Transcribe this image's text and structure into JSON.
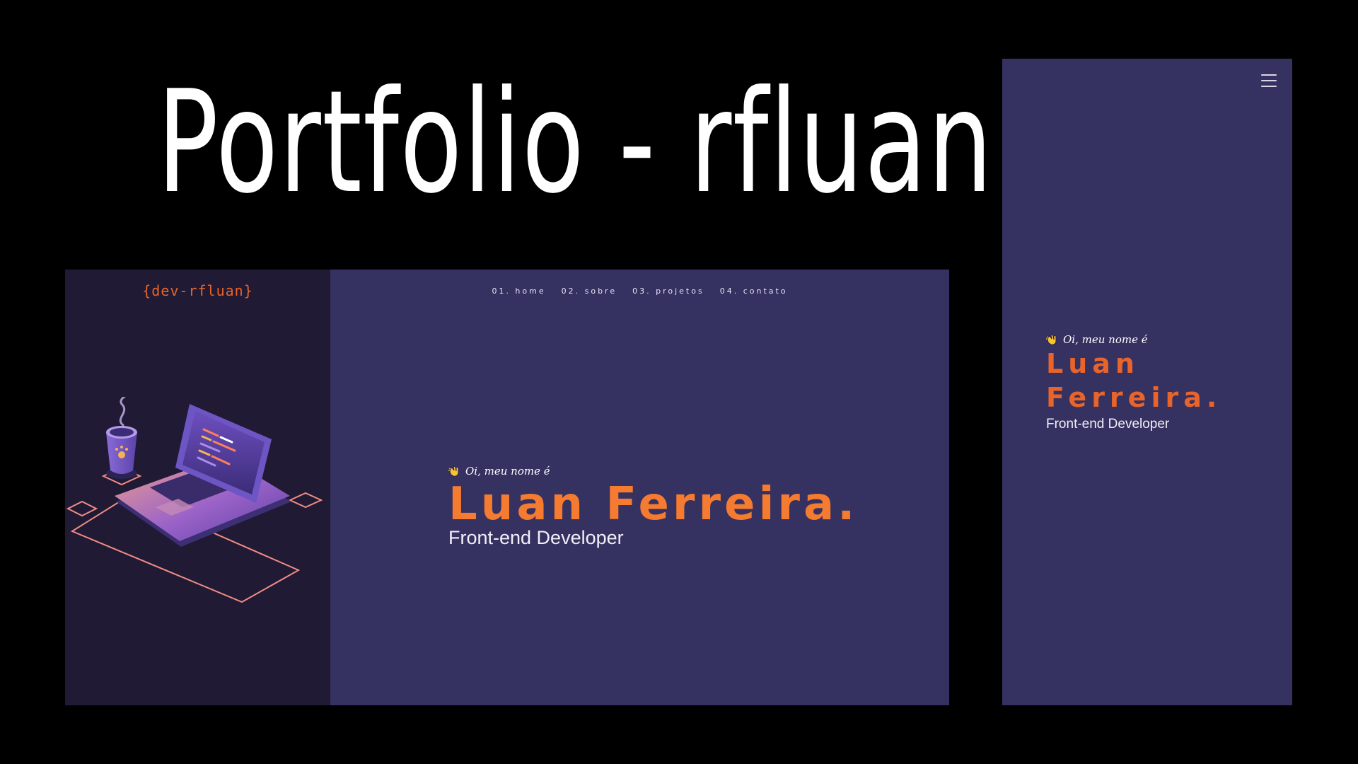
{
  "title": "Portfolio - rfluan",
  "desktop": {
    "logo": "{dev-rfluan}",
    "nav": [
      {
        "label": "01. home"
      },
      {
        "label": "02. sobre"
      },
      {
        "label": "03. projetos"
      },
      {
        "label": "04. contato"
      }
    ],
    "greeting": "Oi, meu nome é",
    "name": "Luan Ferreira.",
    "role": "Front-end Developer"
  },
  "mobile": {
    "greeting": "Oi, meu nome é",
    "name_line1": "Luan",
    "name_line2": "Ferreira.",
    "role": "Front-end Developer",
    "menu_icon": "hamburger-menu-icon"
  },
  "colors": {
    "page_background": "#000000",
    "sidebar": "#201a35",
    "main": "#353160",
    "accent": "#f47b30",
    "text": "#f1eff8"
  },
  "icons": {
    "wave": "waving-hand-icon",
    "illustration": "laptop-coffee-illustration"
  }
}
